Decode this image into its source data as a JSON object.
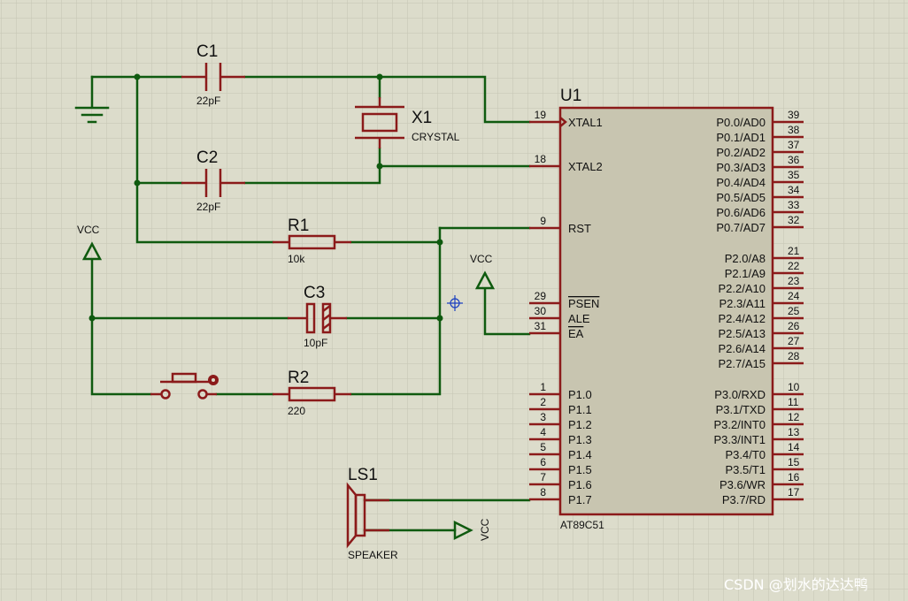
{
  "components": {
    "c1": {
      "ref": "C1",
      "value": "22pF"
    },
    "c2": {
      "ref": "C2",
      "value": "22pF"
    },
    "x1": {
      "ref": "X1",
      "value": "CRYSTAL"
    },
    "r1": {
      "ref": "R1",
      "value": "10k"
    },
    "c3": {
      "ref": "C3",
      "value": "10pF"
    },
    "r2": {
      "ref": "R2",
      "value": "220"
    },
    "ls1": {
      "ref": "LS1",
      "value": "SPEAKER"
    },
    "u1": {
      "ref": "U1",
      "value": "AT89C51"
    }
  },
  "power": {
    "vcc_left": "VCC",
    "vcc_mid": "VCC",
    "vcc_speaker": "VCC"
  },
  "u1_left_pins": [
    {
      "num": "19",
      "name": "XTAL1"
    },
    {
      "num": "18",
      "name": "XTAL2"
    },
    {
      "num": "9",
      "name": "RST"
    },
    {
      "num": "29",
      "name": "PSEN",
      "overline": true
    },
    {
      "num": "30",
      "name": "ALE"
    },
    {
      "num": "31",
      "name": "EA",
      "overline": true
    },
    {
      "num": "1",
      "name": "P1.0"
    },
    {
      "num": "2",
      "name": "P1.1"
    },
    {
      "num": "3",
      "name": "P1.2"
    },
    {
      "num": "4",
      "name": "P1.3"
    },
    {
      "num": "5",
      "name": "P1.4"
    },
    {
      "num": "6",
      "name": "P1.5"
    },
    {
      "num": "7",
      "name": "P1.6"
    },
    {
      "num": "8",
      "name": "P1.7"
    }
  ],
  "u1_right_pins": [
    {
      "num": "39",
      "name": "P0.0/AD0"
    },
    {
      "num": "38",
      "name": "P0.1/AD1"
    },
    {
      "num": "37",
      "name": "P0.2/AD2"
    },
    {
      "num": "36",
      "name": "P0.3/AD3"
    },
    {
      "num": "35",
      "name": "P0.4/AD4"
    },
    {
      "num": "34",
      "name": "P0.5/AD5"
    },
    {
      "num": "33",
      "name": "P0.6/AD6"
    },
    {
      "num": "32",
      "name": "P0.7/AD7"
    },
    {
      "num": "21",
      "name": "P2.0/A8"
    },
    {
      "num": "22",
      "name": "P2.1/A9"
    },
    {
      "num": "23",
      "name": "P2.2/A10"
    },
    {
      "num": "24",
      "name": "P2.3/A11"
    },
    {
      "num": "25",
      "name": "P2.4/A12"
    },
    {
      "num": "26",
      "name": "P2.5/A13"
    },
    {
      "num": "27",
      "name": "P2.6/A14"
    },
    {
      "num": "28",
      "name": "P2.7/A15"
    },
    {
      "num": "10",
      "name": "P3.0/RXD"
    },
    {
      "num": "11",
      "name": "P3.1/TXD"
    },
    {
      "num": "12",
      "name": "P3.2/INT0"
    },
    {
      "num": "13",
      "name": "P3.3/INT1"
    },
    {
      "num": "14",
      "name": "P3.4/T0"
    },
    {
      "num": "15",
      "name": "P3.5/T1"
    },
    {
      "num": "16",
      "name": "P3.6/WR"
    },
    {
      "num": "17",
      "name": "P3.7/RD"
    }
  ],
  "watermark": "CSDN @划水的达达鸭",
  "colors": {
    "background": "#dcdccb",
    "grid": "#c5c5b3",
    "wire": "#0f5a0f",
    "component": "#8b1a1a",
    "chip_fill": "#c8c5b0"
  }
}
